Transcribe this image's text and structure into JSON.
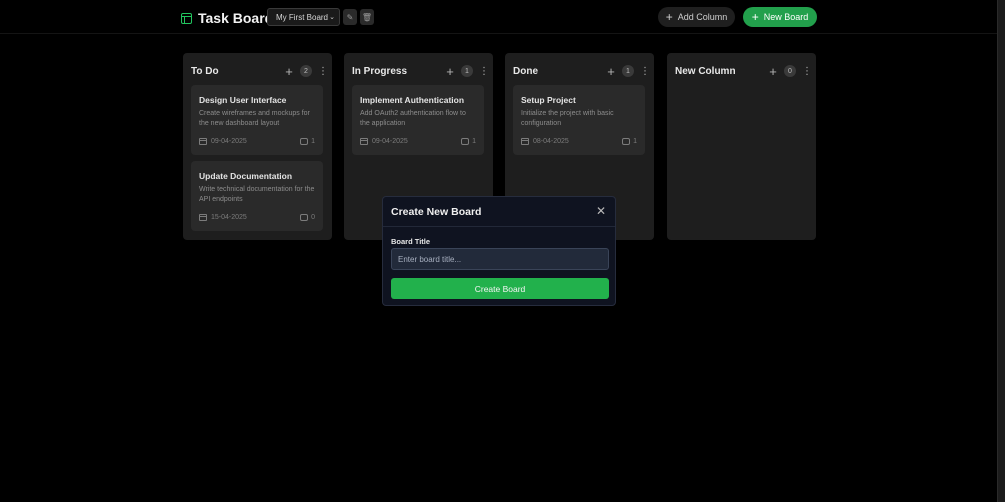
{
  "header": {
    "app_title": "Task Board",
    "board_select": {
      "selected": "My First Board"
    },
    "edit_icon": "pencil-icon",
    "delete_icon": "trash-icon",
    "add_column_label": "Add Column",
    "new_board_label": "New Board"
  },
  "columns": [
    {
      "title": "To Do",
      "count": "2",
      "cards": [
        {
          "title": "Design User Interface",
          "description": "Create wireframes and mockups for the new dashboard layout",
          "date": "09-04-2025",
          "comments": "1"
        },
        {
          "title": "Update Documentation",
          "description": "Write technical documentation for the API endpoints",
          "date": "15-04-2025",
          "comments": "0"
        }
      ]
    },
    {
      "title": "In Progress",
      "count": "1",
      "cards": [
        {
          "title": "Implement Authentication",
          "description": "Add OAuth2 authentication flow to the application",
          "date": "09-04-2025",
          "comments": "1"
        }
      ]
    },
    {
      "title": "Done",
      "count": "1",
      "cards": [
        {
          "title": "Setup Project",
          "description": "Initialize the project with basic configuration",
          "date": "08-04-2025",
          "comments": "1"
        }
      ]
    },
    {
      "title": "New Column",
      "count": "0",
      "cards": []
    }
  ],
  "modal": {
    "title": "Create New Board",
    "field_label": "Board Title",
    "input_value": "",
    "input_placeholder": "Enter board title...",
    "submit_label": "Create Board"
  },
  "colors": {
    "accent": "#22a04c",
    "background": "#000000",
    "column_bg": "#1e1e1e",
    "card_bg": "#2a2a2a",
    "modal_bg": "#0f1320"
  }
}
